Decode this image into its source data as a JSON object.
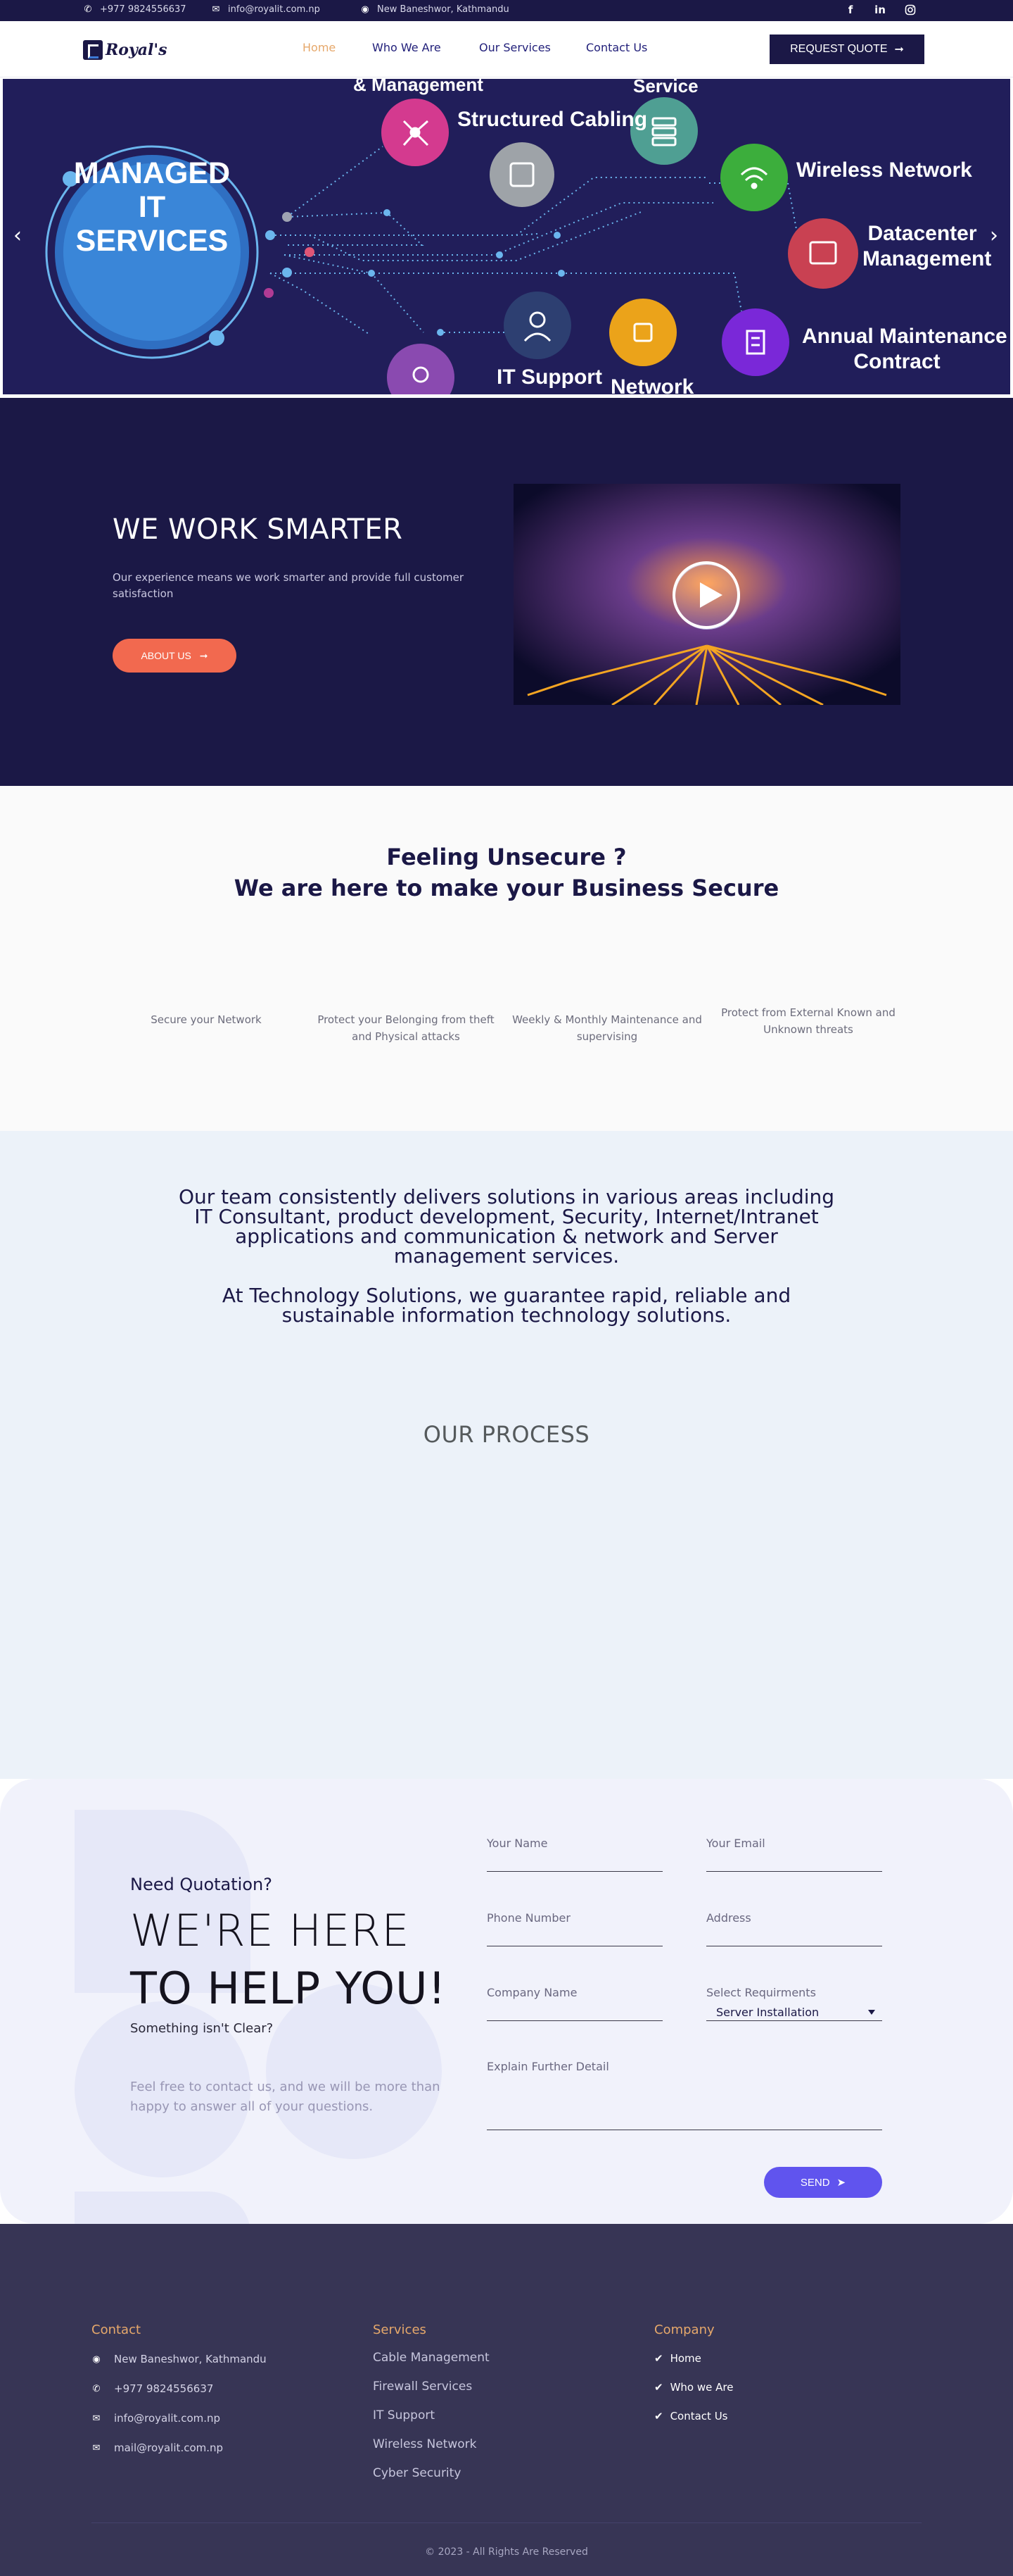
{
  "topbar": {
    "phone": "+977 9824556637",
    "email": "info@royalit.com.np",
    "location": "New Baneshwor, Kathmandu",
    "social": [
      "f",
      "in",
      "ig"
    ]
  },
  "header": {
    "logo_text": "Royal's",
    "nav": [
      {
        "label": "Home",
        "active": true
      },
      {
        "label": "Who We Are",
        "active": false
      },
      {
        "label": "Our Services",
        "active": false
      },
      {
        "label": "Contact Us",
        "active": false
      }
    ],
    "quote_button": "REQUEST QUOTE"
  },
  "hero": {
    "center_title_line1": "MANAGED",
    "center_title_line2": "IT SERVICES",
    "labels": {
      "management": "& Management",
      "service": "Service",
      "structured_cabling": "Structured Cabling",
      "wireless_network": "Wireless Network",
      "datacenter": "Datacenter",
      "datacenter_line2": "Management",
      "amc_line1": "Annual Maintenance",
      "amc_line2": "Contract",
      "it_support": "IT Support",
      "network": "Network"
    },
    "colors": {
      "background": "#211e5a",
      "accent_blue": "#6bb6ee"
    }
  },
  "smarter": {
    "title": "WE WORK SMARTER",
    "text": "Our experience means we work smarter and provide full customer satisfaction",
    "button": "ABOUT US"
  },
  "secure": {
    "title_line1": "Feeling Unsecure ?",
    "title_line2": "We are here to make your Business Secure",
    "features": [
      "Secure your Network",
      "Protect your Belonging from theft and Physical attacks",
      "Weekly & Monthly Maintenance and supervising",
      "Protect from External Known and Unknown threats"
    ]
  },
  "solutions": {
    "paragraph1": "Our team consistently delivers solutions in various areas including IT Consultant, product development, Security, Internet/Intranet applications and communication & network and Server management services.",
    "paragraph2": "At Technology Solutions, we guarantee rapid, reliable and sustainable information technology solutions.",
    "process_title": "OUR PROCESS"
  },
  "contact": {
    "need_quotation": "Need Quotation?",
    "headline_line1": "WE'RE HERE",
    "headline_line2": "TO HELP YOU!",
    "subtitle": "Something isn't Clear?",
    "description": "Feel free to contact us, and we will be more than happy to answer all of your questions.",
    "fields": {
      "name": "Your Name",
      "email": "Your Email",
      "phone": "Phone Number",
      "address": "Address",
      "company": "Company Name",
      "requirements_label": "Select Requirments",
      "requirements_value": "Server Installation",
      "details": "Explain Further Detail"
    },
    "send_button": "SEND"
  },
  "footer": {
    "contact_title": "Contact",
    "contact_items": [
      {
        "icon": "map-marker-icon",
        "text": "New Baneshwor, Kathmandu"
      },
      {
        "icon": "phone-icon",
        "text": "+977 9824556637"
      },
      {
        "icon": "envelope-icon",
        "text": "info@royalit.com.np"
      },
      {
        "icon": "envelope-icon",
        "text": "mail@royalit.com.np"
      }
    ],
    "services_title": "Services",
    "services": [
      "Cable Management",
      "Firewall Services",
      "IT Support",
      "Wireless Network",
      "Cyber Security"
    ],
    "company_title": "Company",
    "company_links": [
      "Home",
      "Who we Are",
      "Contact Us"
    ],
    "copyright": "2023 - All Rights Are Reserved"
  }
}
